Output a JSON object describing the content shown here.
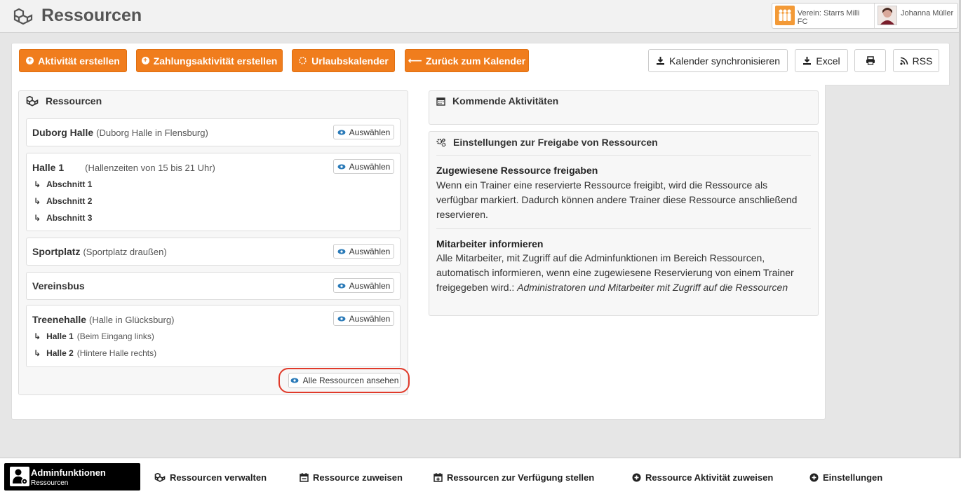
{
  "header": {
    "title": "Ressourcen",
    "club_label": "Verein: Starrs Milli FC",
    "user_name": "Johanna Müller"
  },
  "toolbar": {
    "create_activity": "Aktivität erstellen",
    "create_payment_activity": "Zahlungsaktivität erstellen",
    "vacation_calendar": "Urlaubskalender",
    "back_to_calendar": "Zurück zum Kalender",
    "sync_calendar": "Kalender synchronisieren",
    "excel": "Excel",
    "rss": "RSS"
  },
  "resources_panel": {
    "title": "Ressourcen",
    "select_label": "Auswählen",
    "view_all_label": "Alle Ressourcen ansehen",
    "items": [
      {
        "name": "Duborg Halle",
        "desc": "(Duborg Halle in Flensburg)"
      },
      {
        "name": "Halle 1",
        "desc": "(Hallenzeiten von 15 bis 21 Uhr)",
        "subs": [
          {
            "name": "Abschnitt 1"
          },
          {
            "name": "Abschnitt 2"
          },
          {
            "name": "Abschnitt 3"
          }
        ]
      },
      {
        "name": "Sportplatz",
        "desc": "(Sportplatz draußen)"
      },
      {
        "name": "Vereinsbus",
        "desc": ""
      },
      {
        "name": "Treenehalle",
        "desc": "(Halle in Glücksburg)",
        "subs": [
          {
            "name": "Halle 1",
            "desc": "(Beim Eingang links)"
          },
          {
            "name": "Halle 2",
            "desc": "(Hintere Halle rechts)"
          }
        ]
      }
    ]
  },
  "upcoming_panel": {
    "title": "Kommende Aktivitäten"
  },
  "settings_panel": {
    "title": "Einstellungen zur Freigabe von Ressourcen",
    "section1_title": "Zugewiesene Ressource freigaben",
    "section1_text": "Wenn ein Trainer eine reservierte Ressource freigibt, wird die Ressource als verfügbar markiert. Dadurch können andere Trainer diese Ressource anschließend reservieren.",
    "section2_title": "Mitarbeiter informieren",
    "section2_text": "Alle Mitarbeiter, mit Zugriff auf die Adminfunktionen im Bereich Ressourcen, automatisch informieren, wenn eine zugewiesene Reservierung von einem Trainer freigegeben wird.:",
    "section2_emph": "Administratoren und Mitarbeiter mit Zugriff auf die Ressourcen"
  },
  "bottom_nav": {
    "admin_title": "Adminfunktionen",
    "admin_sub": "Ressourcen",
    "manage": "Ressourcen verwalten",
    "assign": "Ressource zuweisen",
    "provide": "Ressourcen zur Verfügung stellen",
    "assign_activity": "Ressource Aktivität zuweisen",
    "settings": "Einstellungen"
  },
  "colors": {
    "accent": "#f07d1d",
    "highlight_ring": "#e03a2a",
    "eye_icon": "#2a7ab8"
  }
}
